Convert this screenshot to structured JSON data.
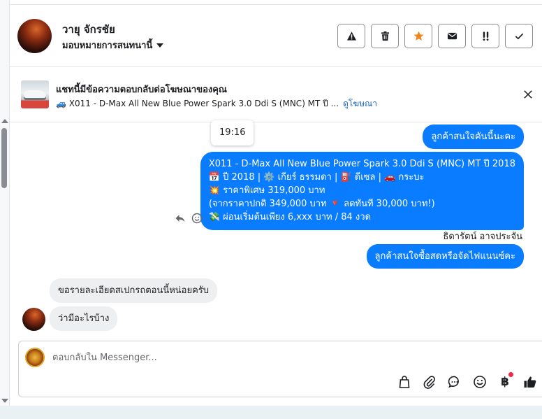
{
  "header": {
    "user_name": "วายุ จักรชัย",
    "assign_label": "มอบหมายการสนทนานี้",
    "actions": [
      {
        "name": "report",
        "icon": "warning-icon"
      },
      {
        "name": "delete",
        "icon": "trash-icon"
      },
      {
        "name": "star",
        "icon": "star-icon"
      },
      {
        "name": "mark-unread",
        "icon": "envelope-icon"
      },
      {
        "name": "follow-up",
        "icon": "follow-up-icon"
      },
      {
        "name": "done",
        "icon": "check-icon"
      }
    ]
  },
  "ad_banner": {
    "title": "แชทนี้มีข้อความตอบกลับต่อโฆษณาของคุณ",
    "ad_text": "🚙 X011 - D-Max All New Blue Power Spark 3.0 Ddi S (MNC) MT ปี ...",
    "link": "ดูโฆษณา"
  },
  "messages": {
    "time": "19:16",
    "out_1": "ลูกค้าสนใจคันนี้นะคะ",
    "out_2_lines": [
      "X011 - D-Max All New Blue Power Spark 3.0 Ddi S (MNC) MT  ปี 2018",
      "📅 ปี 2018 | ⚙️ เกียร์ ธรรมดา | ⛽ ดีเซล | 🚗 กระบะ",
      "💥 ราคาพิเศษ 319,000 บาท",
      "(จากราคาปกติ 349,000 บาท 🔻 ลดทันที 30,000 บาท!)",
      "💸 ผ่อนเริ่มต้นเพียง 6,xxx บาท / 84 งวด"
    ],
    "sender_name": "ธิดารัตน์ อาจประจัน",
    "out_3": "ลูกค้าสนใจซื้อสดหรือจัดไฟแนนซ์คะ",
    "in_1": "ขอรายละเอียดสเปกรถตอนนี้หน่อยครับ",
    "in_2": "ว่ามีอะไรบ้าง"
  },
  "composer": {
    "placeholder": "ตอบกลับใน Messenger...",
    "baht_symbol": "฿",
    "tools": [
      "bag-icon",
      "paperclip-icon",
      "saved-reply-icon",
      "emoji-icon",
      "payment-icon",
      "thumbs-up-icon"
    ]
  },
  "colors": {
    "outgoing_bubble": "#0a7cff",
    "incoming_bubble": "#eeeff1",
    "link": "#1a65c5",
    "star": "#f0851a"
  }
}
